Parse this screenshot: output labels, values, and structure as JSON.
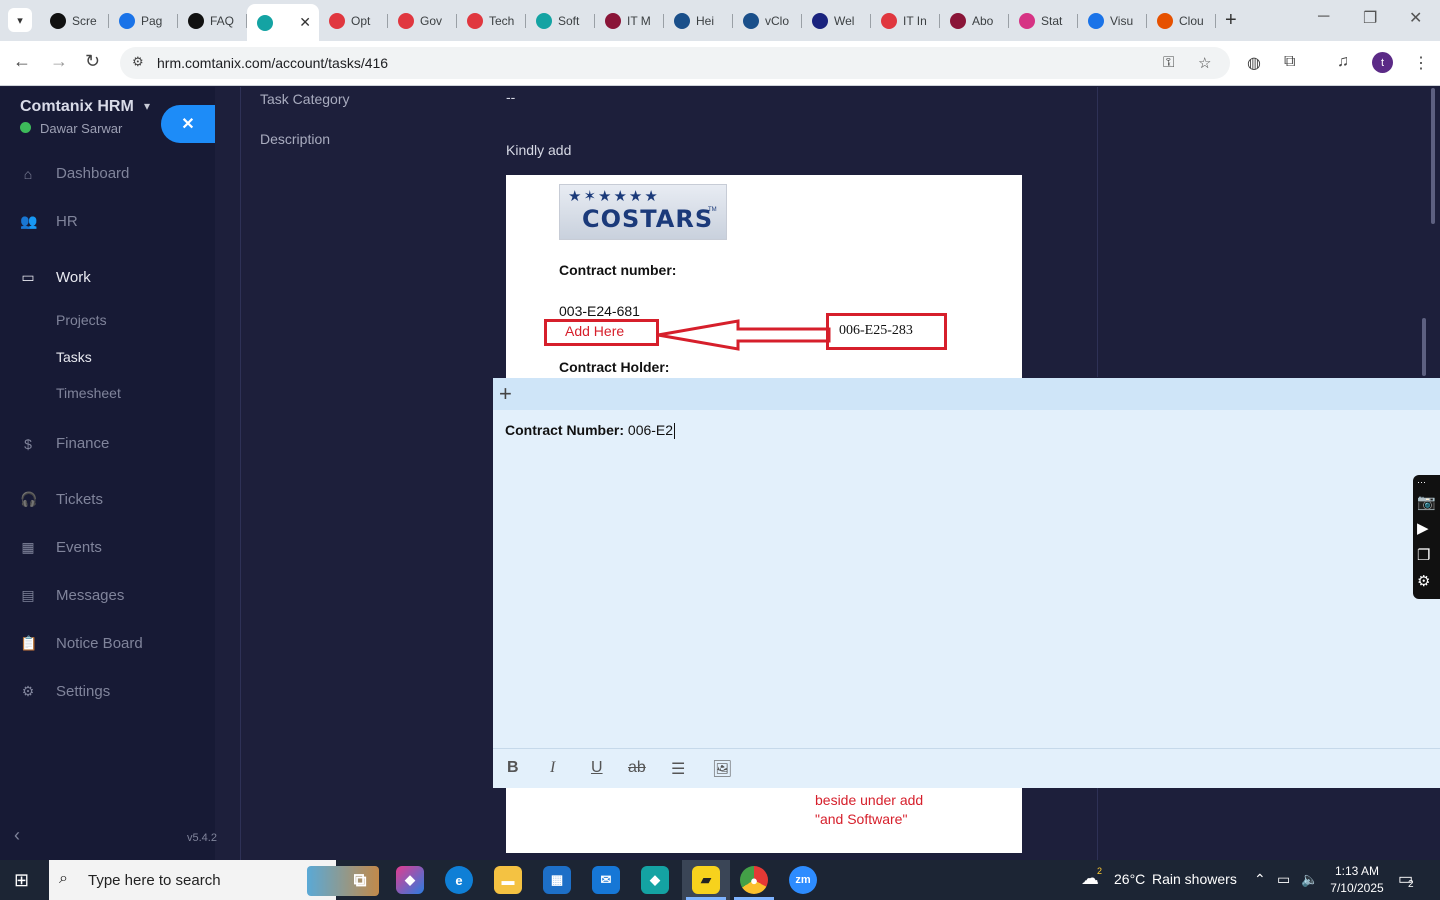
{
  "browser": {
    "tabs": [
      {
        "label": "Scre",
        "color": "#111111"
      },
      {
        "label": "Pag",
        "color": "#1a73e8"
      },
      {
        "label": "FAQ",
        "color": "#111111"
      },
      {
        "label": "",
        "color": "#14a3a3",
        "active": true
      },
      {
        "label": "Opt",
        "color": "#e0373f"
      },
      {
        "label": "Gov",
        "color": "#e0373f"
      },
      {
        "label": "Tech",
        "color": "#e0373f"
      },
      {
        "label": "Soft",
        "color": "#14a3a3"
      },
      {
        "label": "IT M",
        "color": "#8a1538"
      },
      {
        "label": "Hei",
        "color": "#1a4f8a"
      },
      {
        "label": "vClo",
        "color": "#1a4f8a"
      },
      {
        "label": "Wel",
        "color": "#1a237e"
      },
      {
        "label": "IT In",
        "color": "#e0373f"
      },
      {
        "label": "Abo",
        "color": "#8a1538"
      },
      {
        "label": "Stat",
        "color": "#d63384"
      },
      {
        "label": "Visu",
        "color": "#1a73e8"
      },
      {
        "label": "Clou",
        "color": "#e65100"
      }
    ],
    "url": "hrm.comtanix.com/account/tasks/416",
    "profile_initial": "t"
  },
  "sidebar": {
    "brand": "Comtanix HRM",
    "user": "Dawar Sarwar",
    "nav": [
      {
        "label": "Dashboard",
        "icon": "⌂"
      },
      {
        "label": "HR",
        "icon": "👥"
      },
      {
        "label": "Work",
        "icon": "▭",
        "active": true
      },
      {
        "label": "Finance",
        "icon": "$"
      },
      {
        "label": "Tickets",
        "icon": "🎧"
      },
      {
        "label": "Events",
        "icon": "▦"
      },
      {
        "label": "Messages",
        "icon": "▤"
      },
      {
        "label": "Notice Board",
        "icon": "📋"
      },
      {
        "label": "Settings",
        "icon": "⚙"
      }
    ],
    "work_sub": [
      "Projects",
      "Tasks",
      "Timesheet"
    ],
    "version": "v5.4.2"
  },
  "task": {
    "category_label": "Task Category",
    "category_value": "--",
    "description_label": "Description",
    "description_intro": "Kindly add"
  },
  "doc_image": {
    "logo_text": "COSTARS",
    "contract_number_label": "Contract number:",
    "contract_number_value": "003-E24-681",
    "add_here": "Add Here",
    "new_number": "006-E25-283",
    "holder_label": "Contract Holder:",
    "note_line1": "beside under add",
    "note_line2": "\"and Software\""
  },
  "sticky_note": {
    "bold_label": "Contract Number:",
    "typed_value": "006-E2"
  },
  "taskbar": {
    "search_placeholder": "Type here to search",
    "weather_temp": "26°C",
    "weather_text": "Rain showers",
    "weather_badge": "2",
    "time": "1:13 AM",
    "date": "7/10/2025",
    "notif_count": "2"
  }
}
